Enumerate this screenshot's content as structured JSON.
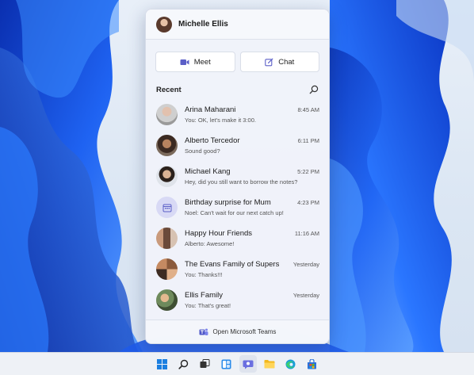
{
  "user": {
    "name": "Michelle Ellis"
  },
  "actions": [
    {
      "label": "Meet",
      "icon": "video-camera-icon"
    },
    {
      "label": "Chat",
      "icon": "compose-icon"
    }
  ],
  "recent": {
    "title": "Recent",
    "conversations": [
      {
        "name": "Arina Maharani",
        "time": "8:45 AM",
        "preview": "You: OK, let's make it 3:00."
      },
      {
        "name": "Alberto Tercedor",
        "time": "6:11 PM",
        "preview": "Sound good?"
      },
      {
        "name": "Michael Kang",
        "time": "5:22 PM",
        "preview": "Hey, did you still want to borrow the notes?"
      },
      {
        "name": "Birthday surprise for Mum",
        "time": "4:23 PM",
        "preview": "Noel: Can't wait for our next catch up!"
      },
      {
        "name": "Happy Hour Friends",
        "time": "11:16 AM",
        "preview": "Alberto: Awesome!"
      },
      {
        "name": "The Evans Family of Supers",
        "time": "Yesterday",
        "preview": "You: Thanks!!!"
      },
      {
        "name": "Ellis Family",
        "time": "Yesterday",
        "preview": "You: That's great!"
      }
    ]
  },
  "footer": {
    "label": "Open Microsoft Teams"
  },
  "taskbar": {
    "icons": [
      "windows-start-icon",
      "search-icon",
      "task-view-icon",
      "widgets-icon",
      "teams-chat-icon",
      "file-explorer-icon",
      "edge-browser-icon",
      "store-icon"
    ]
  },
  "colors": {
    "accent": "#5b5fc7",
    "wallpaper_blue": "#1a55e0"
  }
}
